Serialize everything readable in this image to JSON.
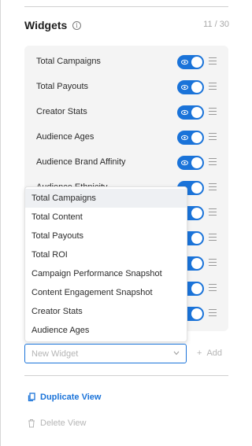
{
  "header": {
    "title": "Widgets",
    "info_icon": "info-icon",
    "count": "11 / 30"
  },
  "widgets": [
    {
      "label": "Total Campaigns"
    },
    {
      "label": "Total Payouts"
    },
    {
      "label": "Creator Stats"
    },
    {
      "label": "Audience Ages"
    },
    {
      "label": "Audience Brand Affinity"
    },
    {
      "label": "Audience Ethnicity"
    },
    {
      "label": ""
    },
    {
      "label": ""
    },
    {
      "label": ""
    },
    {
      "label": ""
    },
    {
      "label": ""
    }
  ],
  "dropdown": {
    "options": [
      "Total Campaigns",
      "Total Content",
      "Total Payouts",
      "Total ROI",
      "Campaign Performance Snapshot",
      "Content Engagement Snapshot",
      "Creator Stats",
      "Audience Ages"
    ],
    "highlighted_index": 0
  },
  "new_widget": {
    "placeholder": "New Widget",
    "add_label": "Add"
  },
  "actions": {
    "duplicate": "Duplicate View",
    "delete": "Delete View"
  },
  "colors": {
    "accent": "#1a73d9",
    "panel": "#f4f4f4",
    "muted": "#b5b5b5"
  }
}
